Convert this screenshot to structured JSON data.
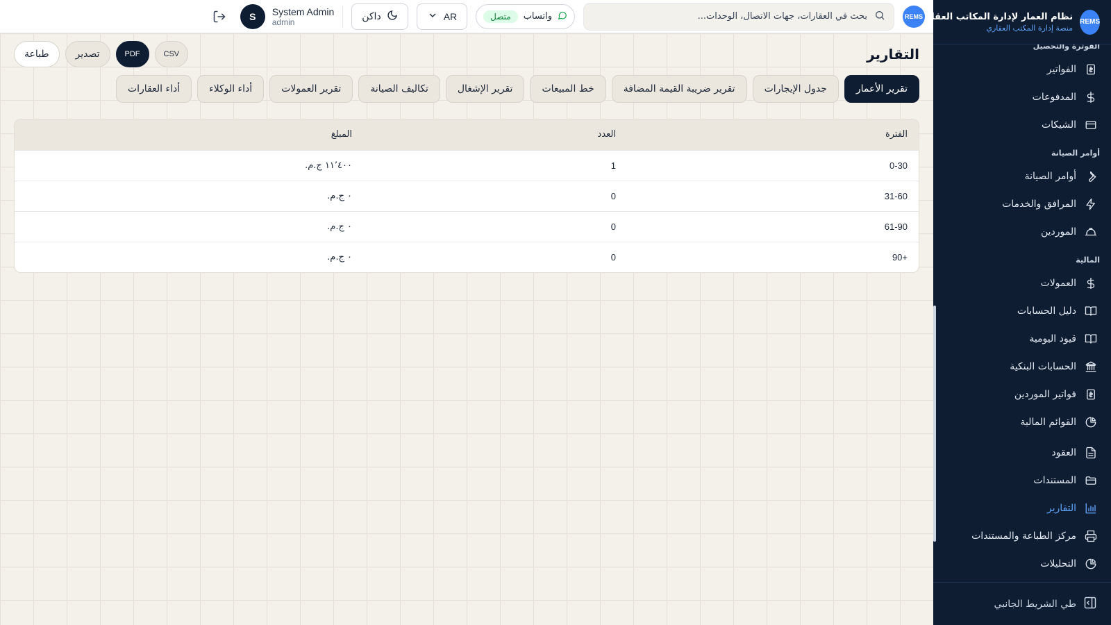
{
  "brand": {
    "logo_text": "REMS",
    "name": "نظام العمار لإدارة المكاتب العقارية",
    "subtitle": "منصة إدارة المكتب العقاري"
  },
  "sidebar": {
    "sections": [
      {
        "title": "الفوترة والتحصيل",
        "items": [
          {
            "label": "الفواتير",
            "icon": "invoice-icon"
          },
          {
            "label": "المدفوعات",
            "icon": "dollar-icon"
          },
          {
            "label": "الشيكات",
            "icon": "card-icon"
          }
        ]
      },
      {
        "title": "أوامر الصيانة",
        "items": [
          {
            "label": "أوامر الصيانة",
            "icon": "wrench-icon"
          },
          {
            "label": "المرافق والخدمات",
            "icon": "bolt-icon"
          },
          {
            "label": "الموردين",
            "icon": "helmet-icon"
          }
        ]
      },
      {
        "title": "المالية",
        "items": [
          {
            "label": "العمولات",
            "icon": "dollar-icon"
          },
          {
            "label": "دليل الحسابات",
            "icon": "book-icon"
          },
          {
            "label": "قيود اليومية",
            "icon": "book-icon"
          },
          {
            "label": "الحسابات البنكية",
            "icon": "bank-icon"
          },
          {
            "label": "فواتير الموردين",
            "icon": "invoice-icon"
          },
          {
            "label": "القوائم المالية",
            "icon": "pie-icon"
          }
        ]
      },
      {
        "title": "",
        "items": [
          {
            "label": "العقود",
            "icon": "document-icon"
          },
          {
            "label": "المستندات",
            "icon": "folder-icon"
          },
          {
            "label": "التقارير",
            "icon": "bar-chart-icon",
            "active": true
          },
          {
            "label": "مركز الطباعة والمستندات",
            "icon": "printer-icon"
          },
          {
            "label": "التحليلات",
            "icon": "pie-icon"
          }
        ]
      }
    ],
    "collapse_label": "طي الشريط الجانبي"
  },
  "topbar": {
    "search_placeholder": "بحث في العقارات، جهات الاتصال، الوحدات...",
    "whatsapp_label": "واتساب",
    "whatsapp_status": "متصل",
    "language": "AR",
    "theme_label": "داكن",
    "user_name": "System Admin",
    "user_role": "admin",
    "avatar_initial": "S"
  },
  "page": {
    "title": "التقارير",
    "actions": {
      "print": "طباعة",
      "export": "تصدير",
      "pdf": "PDF",
      "csv": "CSV"
    },
    "tabs": [
      {
        "label": "تقرير الأعمار",
        "active": true
      },
      {
        "label": "جدول الإيجارات"
      },
      {
        "label": "تقرير ضريبة القيمة المضافة"
      },
      {
        "label": "خط المبيعات"
      },
      {
        "label": "تقرير الإشغال"
      },
      {
        "label": "تكاليف الصيانة"
      },
      {
        "label": "تقرير العمولات"
      },
      {
        "label": "أداء الوكلاء"
      },
      {
        "label": "أداء العقارات"
      }
    ],
    "table": {
      "headers": [
        "الفترة",
        "العدد",
        "المبلغ"
      ],
      "rows": [
        [
          "0-30",
          "1",
          "١١٬٤٠٠ ج.م."
        ],
        [
          "31-60",
          "0",
          "٠ ج.م."
        ],
        [
          "61-90",
          "0",
          "٠ ج.م."
        ],
        [
          "90+",
          "0",
          "٠ ج.م."
        ]
      ]
    }
  },
  "colors": {
    "sidebar_bg": "#0f1d33",
    "accent": "#3b82f6",
    "active_link": "#60a5fa",
    "page_bg": "#f4f1ea",
    "status_green": "#15803d"
  }
}
